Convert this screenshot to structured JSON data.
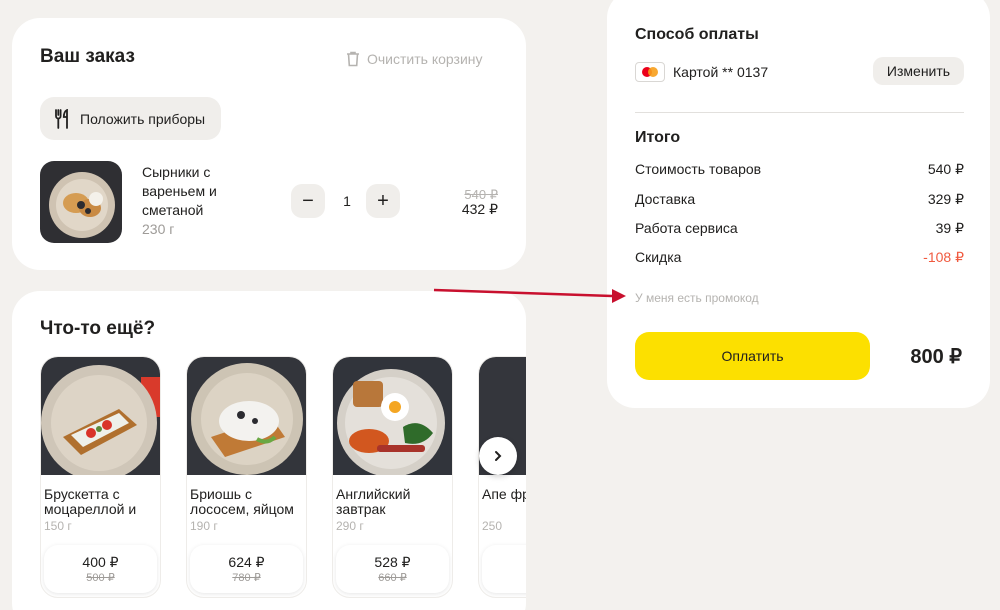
{
  "order": {
    "title": "Ваш заказ",
    "clear_label": "Очистить корзину",
    "cutlery_label": "Положить приборы",
    "item": {
      "name": "Сырники с вареньем и сметаной",
      "weight": "230 г",
      "quantity": "1",
      "old_price": "540 ₽",
      "price": "432 ₽",
      "minus": "−",
      "plus": "+"
    }
  },
  "more": {
    "title": "Что-то ещё?",
    "products": [
      {
        "name": "Брускетта с моцареллой и",
        "weight": "150 г",
        "price": "400 ₽",
        "old_price": "500 ₽"
      },
      {
        "name": "Бриошь с лососем, яйцом",
        "weight": "190 г",
        "price": "624 ₽",
        "old_price": "780 ₽"
      },
      {
        "name": "Английский завтрак",
        "weight": "290 г",
        "price": "528 ₽",
        "old_price": "660 ₽"
      },
      {
        "name": "Апе фре",
        "weight": "250",
        "price": "",
        "old_price": ""
      }
    ]
  },
  "payment": {
    "title": "Способ оплаты",
    "card_label": "Картой ** 0137",
    "change_label": "Изменить",
    "total_title": "Итого",
    "rows": [
      {
        "label": "Стоимость товаров",
        "value": "540 ₽"
      },
      {
        "label": "Доставка",
        "value": "329 ₽"
      },
      {
        "label": "Работа сервиса",
        "value": "39 ₽"
      },
      {
        "label": "Скидка",
        "value": "-108 ₽"
      }
    ],
    "promo_label": "У меня есть промокод",
    "pay_label": "Оплатить",
    "grand_total": "800 ₽"
  },
  "colors": {
    "accent": "#fce000",
    "discount": "#f05a3f",
    "arrow": "#c8102e"
  }
}
